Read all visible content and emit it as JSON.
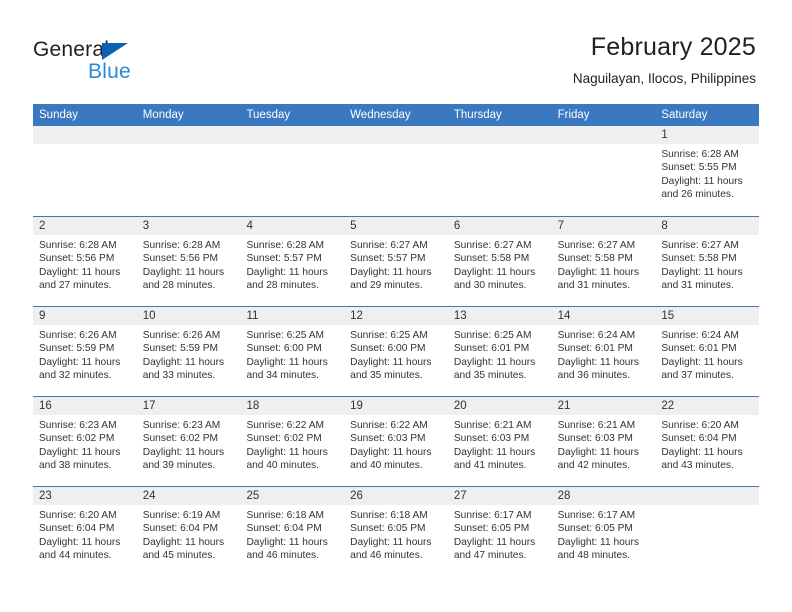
{
  "brand": {
    "name_top": "General",
    "name_bottom": "Blue",
    "triangle_color": "#0a62b0",
    "blue_text_color": "#2b8bd6"
  },
  "header": {
    "title": "February 2025",
    "subtitle": "Naguilayan, Ilocos, Philippines"
  },
  "theme": {
    "header_blue": "#3a78bf",
    "daynum_band": "#efefef",
    "text": "#333333"
  },
  "weekdays": [
    "Sunday",
    "Monday",
    "Tuesday",
    "Wednesday",
    "Thursday",
    "Friday",
    "Saturday"
  ],
  "weeks": [
    [
      {
        "day": "",
        "sunrise": "",
        "sunset": "",
        "daylight_line1": "",
        "daylight_line2": ""
      },
      {
        "day": "",
        "sunrise": "",
        "sunset": "",
        "daylight_line1": "",
        "daylight_line2": ""
      },
      {
        "day": "",
        "sunrise": "",
        "sunset": "",
        "daylight_line1": "",
        "daylight_line2": ""
      },
      {
        "day": "",
        "sunrise": "",
        "sunset": "",
        "daylight_line1": "",
        "daylight_line2": ""
      },
      {
        "day": "",
        "sunrise": "",
        "sunset": "",
        "daylight_line1": "",
        "daylight_line2": ""
      },
      {
        "day": "",
        "sunrise": "",
        "sunset": "",
        "daylight_line1": "",
        "daylight_line2": ""
      },
      {
        "day": "1",
        "sunrise": "Sunrise: 6:28 AM",
        "sunset": "Sunset: 5:55 PM",
        "daylight_line1": "Daylight: 11 hours",
        "daylight_line2": "and 26 minutes."
      }
    ],
    [
      {
        "day": "2",
        "sunrise": "Sunrise: 6:28 AM",
        "sunset": "Sunset: 5:56 PM",
        "daylight_line1": "Daylight: 11 hours",
        "daylight_line2": "and 27 minutes."
      },
      {
        "day": "3",
        "sunrise": "Sunrise: 6:28 AM",
        "sunset": "Sunset: 5:56 PM",
        "daylight_line1": "Daylight: 11 hours",
        "daylight_line2": "and 28 minutes."
      },
      {
        "day": "4",
        "sunrise": "Sunrise: 6:28 AM",
        "sunset": "Sunset: 5:57 PM",
        "daylight_line1": "Daylight: 11 hours",
        "daylight_line2": "and 28 minutes."
      },
      {
        "day": "5",
        "sunrise": "Sunrise: 6:27 AM",
        "sunset": "Sunset: 5:57 PM",
        "daylight_line1": "Daylight: 11 hours",
        "daylight_line2": "and 29 minutes."
      },
      {
        "day": "6",
        "sunrise": "Sunrise: 6:27 AM",
        "sunset": "Sunset: 5:58 PM",
        "daylight_line1": "Daylight: 11 hours",
        "daylight_line2": "and 30 minutes."
      },
      {
        "day": "7",
        "sunrise": "Sunrise: 6:27 AM",
        "sunset": "Sunset: 5:58 PM",
        "daylight_line1": "Daylight: 11 hours",
        "daylight_line2": "and 31 minutes."
      },
      {
        "day": "8",
        "sunrise": "Sunrise: 6:27 AM",
        "sunset": "Sunset: 5:58 PM",
        "daylight_line1": "Daylight: 11 hours",
        "daylight_line2": "and 31 minutes."
      }
    ],
    [
      {
        "day": "9",
        "sunrise": "Sunrise: 6:26 AM",
        "sunset": "Sunset: 5:59 PM",
        "daylight_line1": "Daylight: 11 hours",
        "daylight_line2": "and 32 minutes."
      },
      {
        "day": "10",
        "sunrise": "Sunrise: 6:26 AM",
        "sunset": "Sunset: 5:59 PM",
        "daylight_line1": "Daylight: 11 hours",
        "daylight_line2": "and 33 minutes."
      },
      {
        "day": "11",
        "sunrise": "Sunrise: 6:25 AM",
        "sunset": "Sunset: 6:00 PM",
        "daylight_line1": "Daylight: 11 hours",
        "daylight_line2": "and 34 minutes."
      },
      {
        "day": "12",
        "sunrise": "Sunrise: 6:25 AM",
        "sunset": "Sunset: 6:00 PM",
        "daylight_line1": "Daylight: 11 hours",
        "daylight_line2": "and 35 minutes."
      },
      {
        "day": "13",
        "sunrise": "Sunrise: 6:25 AM",
        "sunset": "Sunset: 6:01 PM",
        "daylight_line1": "Daylight: 11 hours",
        "daylight_line2": "and 35 minutes."
      },
      {
        "day": "14",
        "sunrise": "Sunrise: 6:24 AM",
        "sunset": "Sunset: 6:01 PM",
        "daylight_line1": "Daylight: 11 hours",
        "daylight_line2": "and 36 minutes."
      },
      {
        "day": "15",
        "sunrise": "Sunrise: 6:24 AM",
        "sunset": "Sunset: 6:01 PM",
        "daylight_line1": "Daylight: 11 hours",
        "daylight_line2": "and 37 minutes."
      }
    ],
    [
      {
        "day": "16",
        "sunrise": "Sunrise: 6:23 AM",
        "sunset": "Sunset: 6:02 PM",
        "daylight_line1": "Daylight: 11 hours",
        "daylight_line2": "and 38 minutes."
      },
      {
        "day": "17",
        "sunrise": "Sunrise: 6:23 AM",
        "sunset": "Sunset: 6:02 PM",
        "daylight_line1": "Daylight: 11 hours",
        "daylight_line2": "and 39 minutes."
      },
      {
        "day": "18",
        "sunrise": "Sunrise: 6:22 AM",
        "sunset": "Sunset: 6:02 PM",
        "daylight_line1": "Daylight: 11 hours",
        "daylight_line2": "and 40 minutes."
      },
      {
        "day": "19",
        "sunrise": "Sunrise: 6:22 AM",
        "sunset": "Sunset: 6:03 PM",
        "daylight_line1": "Daylight: 11 hours",
        "daylight_line2": "and 40 minutes."
      },
      {
        "day": "20",
        "sunrise": "Sunrise: 6:21 AM",
        "sunset": "Sunset: 6:03 PM",
        "daylight_line1": "Daylight: 11 hours",
        "daylight_line2": "and 41 minutes."
      },
      {
        "day": "21",
        "sunrise": "Sunrise: 6:21 AM",
        "sunset": "Sunset: 6:03 PM",
        "daylight_line1": "Daylight: 11 hours",
        "daylight_line2": "and 42 minutes."
      },
      {
        "day": "22",
        "sunrise": "Sunrise: 6:20 AM",
        "sunset": "Sunset: 6:04 PM",
        "daylight_line1": "Daylight: 11 hours",
        "daylight_line2": "and 43 minutes."
      }
    ],
    [
      {
        "day": "23",
        "sunrise": "Sunrise: 6:20 AM",
        "sunset": "Sunset: 6:04 PM",
        "daylight_line1": "Daylight: 11 hours",
        "daylight_line2": "and 44 minutes."
      },
      {
        "day": "24",
        "sunrise": "Sunrise: 6:19 AM",
        "sunset": "Sunset: 6:04 PM",
        "daylight_line1": "Daylight: 11 hours",
        "daylight_line2": "and 45 minutes."
      },
      {
        "day": "25",
        "sunrise": "Sunrise: 6:18 AM",
        "sunset": "Sunset: 6:04 PM",
        "daylight_line1": "Daylight: 11 hours",
        "daylight_line2": "and 46 minutes."
      },
      {
        "day": "26",
        "sunrise": "Sunrise: 6:18 AM",
        "sunset": "Sunset: 6:05 PM",
        "daylight_line1": "Daylight: 11 hours",
        "daylight_line2": "and 46 minutes."
      },
      {
        "day": "27",
        "sunrise": "Sunrise: 6:17 AM",
        "sunset": "Sunset: 6:05 PM",
        "daylight_line1": "Daylight: 11 hours",
        "daylight_line2": "and 47 minutes."
      },
      {
        "day": "28",
        "sunrise": "Sunrise: 6:17 AM",
        "sunset": "Sunset: 6:05 PM",
        "daylight_line1": "Daylight: 11 hours",
        "daylight_line2": "and 48 minutes."
      },
      {
        "day": "",
        "sunrise": "",
        "sunset": "",
        "daylight_line1": "",
        "daylight_line2": ""
      }
    ]
  ]
}
